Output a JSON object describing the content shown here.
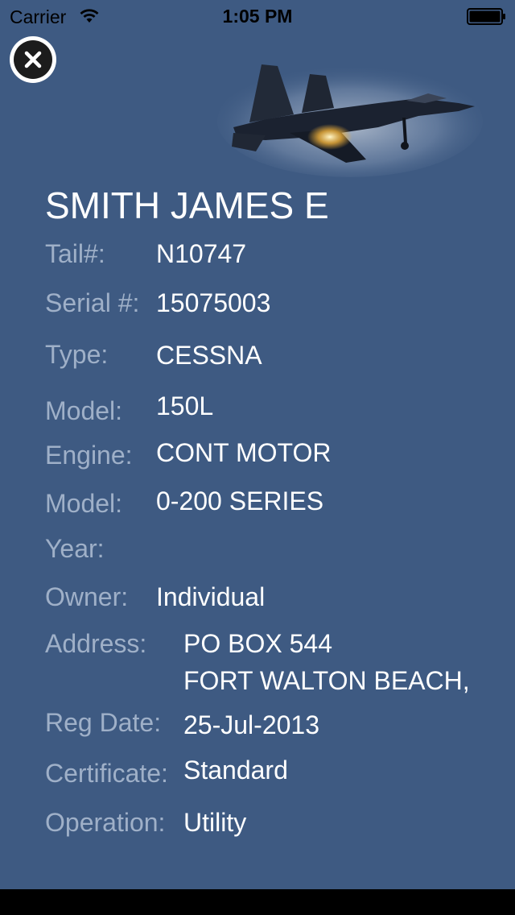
{
  "status_bar": {
    "carrier": "Carrier",
    "time": "1:05 PM"
  },
  "record": {
    "owner_name": "SMITH JAMES E",
    "fields": [
      {
        "label": "Tail#:",
        "value": "N10747"
      },
      {
        "label": "Serial #:",
        "value": "15075003"
      },
      {
        "label": "Type:",
        "value": "CESSNA"
      },
      {
        "label": "Model:",
        "value": "150L"
      },
      {
        "label": "Engine:",
        "value": "CONT MOTOR"
      },
      {
        "label": "Model:",
        "value": "0-200 SERIES"
      },
      {
        "label": "Year:",
        "value": ""
      },
      {
        "label": "Owner:",
        "value": "Individual"
      },
      {
        "label": "Address:",
        "value": "PO BOX 544",
        "value2": "FORT WALTON BEACH,"
      },
      {
        "label": "Reg Date:",
        "value": "25-Jul-2013"
      },
      {
        "label": "Certificate:",
        "value": "Standard"
      },
      {
        "label": "Operation:",
        "value": "Utility"
      }
    ]
  },
  "icons": {
    "close": "close-icon",
    "header_image": "fighter-jet-image",
    "wifi": "wifi-icon",
    "battery": "battery-icon"
  },
  "colors": {
    "background": "#3e5a82",
    "label": "#9fb0c8",
    "value": "#ffffff"
  }
}
